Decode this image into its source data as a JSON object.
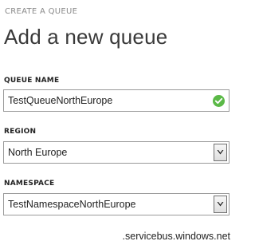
{
  "header": {
    "breadcrumb": "CREATE A QUEUE",
    "title": "Add a new queue"
  },
  "form": {
    "queue_name": {
      "label": "QUEUE NAME",
      "value": "TestQueueNorthEurope",
      "status_icon": "check-icon",
      "status_color": "#5bb947"
    },
    "region": {
      "label": "REGION",
      "selected": "North Europe"
    },
    "namespace": {
      "label": "NAMESPACE",
      "selected": "TestNamespaceNorthEurope",
      "suffix": ".servicebus.windows.net"
    }
  }
}
